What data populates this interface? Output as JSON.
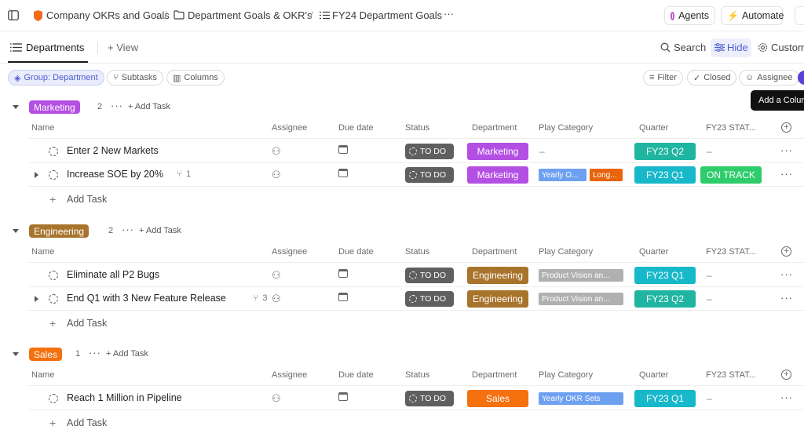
{
  "topbar": {
    "breadcrumbs": [
      "Company OKRs and Goals",
      "Department Goals & OKR's",
      "FY24 Department Goals"
    ],
    "more_label": "···",
    "agents_label": "Agents",
    "automate_label": "Automate"
  },
  "viewbar": {
    "tabs": [
      "Departments"
    ],
    "add_view_label": "+ View",
    "search_label": "Search",
    "hide_label": "Hide",
    "customize_label": "Customize"
  },
  "filterbar": {
    "group_label": "Group: Department",
    "subtasks_label": "Subtasks",
    "columns_label": "Columns",
    "filter_label": "Filter",
    "closed_label": "Closed",
    "assignee_label": "Assignee"
  },
  "tooltip": "Add a Column",
  "columns": [
    "Name",
    "Assignee",
    "Due date",
    "Status",
    "Department",
    "Play Category",
    "Quarter",
    "FY23 STAT..."
  ],
  "add_task_label": "Add Task",
  "add_task_inline": "+ Add Task",
  "groups": [
    {
      "name": "Marketing",
      "count": "2",
      "color": "#b34fe3",
      "tasks": [
        {
          "name": "Enter 2 New Markets",
          "subtasks": "",
          "status": "TO DO",
          "department": "Marketing",
          "play": [],
          "play_empty": "–",
          "quarter": "FY23 Q2",
          "fy23": "–"
        },
        {
          "name": "Increase SOE by 20%",
          "subtasks": "1",
          "status": "TO DO",
          "department": "Marketing",
          "play": [
            {
              "label": "Yearly O...",
              "color": "#6ea0f0"
            },
            {
              "label": "Long...",
              "color": "#e8630a"
            }
          ],
          "play_empty": "",
          "quarter": "FY23 Q1",
          "fy23": "ON TRACK"
        }
      ]
    },
    {
      "name": "Engineering",
      "count": "2",
      "color": "#a8742c",
      "tasks": [
        {
          "name": "Eliminate all P2 Bugs",
          "subtasks": "",
          "status": "TO DO",
          "department": "Engineering",
          "play": [
            {
              "label": "Product Vision an...",
              "color": "#b0b0b0"
            }
          ],
          "play_empty": "",
          "quarter": "FY23 Q1",
          "fy23": "–"
        },
        {
          "name": "End Q1 with 3 New Feature Release",
          "subtasks": "3",
          "status": "TO DO",
          "department": "Engineering",
          "play": [
            {
              "label": "Product Vision an...",
              "color": "#b0b0b0"
            }
          ],
          "play_empty": "",
          "quarter": "FY23 Q2",
          "fy23": "–"
        }
      ]
    },
    {
      "name": "Sales",
      "count": "1",
      "color": "#f5700f",
      "tasks": [
        {
          "name": "Reach 1 Million in Pipeline",
          "subtasks": "",
          "status": "TO DO",
          "department": "Sales",
          "play": [
            {
              "label": "Yearly OKR Sets",
              "color": "#6ea0f0"
            }
          ],
          "play_empty": "",
          "quarter": "FY23 Q1",
          "fy23": "–"
        }
      ]
    }
  ],
  "colors": {
    "on_track": "#2ecc6b",
    "status_todo": "#5f5f5f",
    "quarter": "#17b8c9",
    "accent": "#5b6fd6"
  }
}
